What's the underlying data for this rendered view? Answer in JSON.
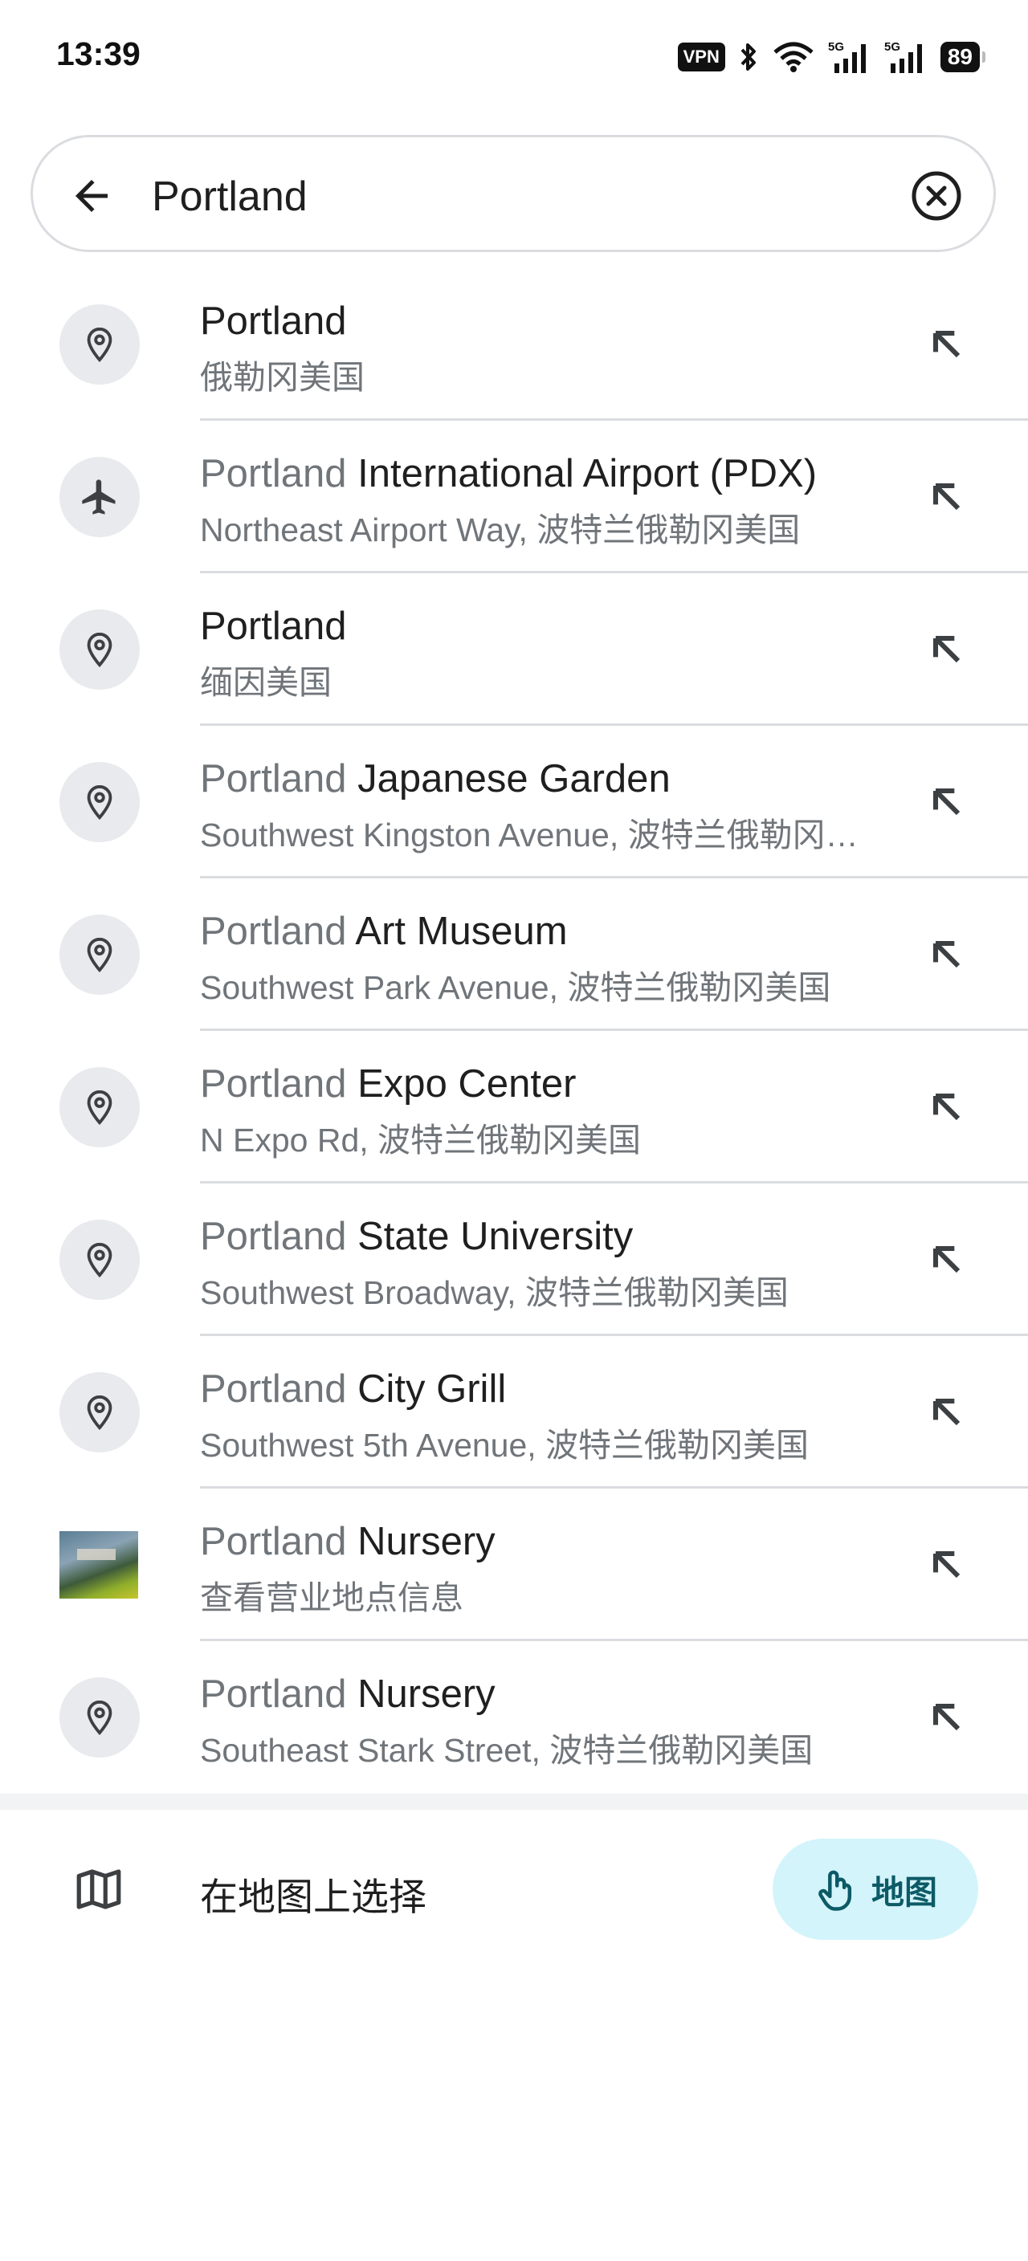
{
  "status_bar": {
    "time": "13:39",
    "vpn": "VPN",
    "battery": "89",
    "icons": [
      "bluetooth-icon",
      "wifi-icon",
      "signal-5g-icon",
      "signal-5g-icon"
    ]
  },
  "search": {
    "query": "Portland",
    "back_icon": "arrow-left-icon",
    "clear_icon": "clear-circle-x-icon"
  },
  "results": [
    {
      "icon": "pin",
      "query_part": "",
      "title_rest": "Portland",
      "subtitle": "俄勒冈美国"
    },
    {
      "icon": "plane",
      "query_part": "Portland",
      "title_rest": " International Airport (PDX)",
      "subtitle": "Northeast Airport Way, 波特兰俄勒冈美国"
    },
    {
      "icon": "pin",
      "query_part": "",
      "title_rest": "Portland",
      "subtitle": "缅因美国"
    },
    {
      "icon": "pin",
      "query_part": "Portland",
      "title_rest": " Japanese Garden",
      "subtitle": "Southwest Kingston Avenue, 波特兰俄勒冈美国"
    },
    {
      "icon": "pin",
      "query_part": "Portland",
      "title_rest": " Art Museum",
      "subtitle": "Southwest Park Avenue, 波特兰俄勒冈美国"
    },
    {
      "icon": "pin",
      "query_part": "Portland",
      "title_rest": " Expo Center",
      "subtitle": "N Expo Rd, 波特兰俄勒冈美国"
    },
    {
      "icon": "pin",
      "query_part": "Portland",
      "title_rest": " State University",
      "subtitle": "Southwest Broadway, 波特兰俄勒冈美国"
    },
    {
      "icon": "pin",
      "query_part": "Portland",
      "title_rest": " City Grill",
      "subtitle": "Southwest 5th Avenue, 波特兰俄勒冈美国"
    },
    {
      "icon": "photo",
      "query_part": "Portland",
      "title_rest": " Nursery",
      "subtitle": "查看营业地点信息"
    },
    {
      "icon": "pin",
      "query_part": "Portland",
      "title_rest": " Nursery",
      "subtitle": "Southeast Stark Street, 波特兰俄勒冈美国"
    }
  ],
  "choose_on_map": {
    "label": "在地图上选择",
    "icon": "map-icon",
    "button_label": "地图",
    "button_icon": "touch-hand-icon"
  },
  "colors": {
    "query_grey": "#70757a",
    "icon_circle": "#e8eaed",
    "map_button_bg": "#d3f4fa",
    "map_button_text": "#0c5a66"
  }
}
